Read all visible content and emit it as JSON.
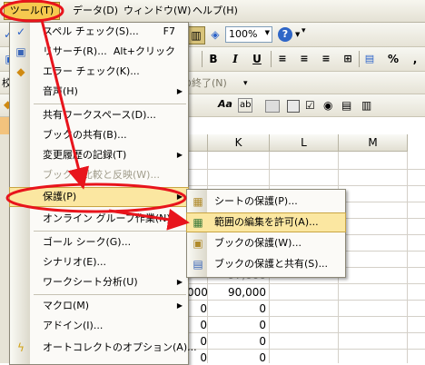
{
  "menubar": {
    "tools": "ツール(T)",
    "data": "データ(D)",
    "window": "ウィンドウ(W)",
    "help": "ヘルプ(H)"
  },
  "toolbar": {
    "zoom": "100%",
    "bold": "B",
    "italic": "I",
    "underline": "U",
    "percent": "%",
    "comma": ",",
    "review_end": "の終了(N)",
    "review_prefix": "校",
    "aa_label": "Aa",
    "ab_label": "ab"
  },
  "grid": {
    "columns": [
      "K",
      "L",
      "M"
    ],
    "cells": {
      "j_partial": "000",
      "k_value": "90,000",
      "k_top_partial": "97,000",
      "zeros": [
        "0",
        "0",
        "0",
        "0"
      ],
      "left_partial": "合"
    }
  },
  "tools_menu": {
    "items": [
      {
        "label": "スペル チェック(S)...",
        "shortcut": "F7"
      },
      {
        "label": "リサーチ(R)...",
        "shortcut": "Alt+クリック"
      },
      {
        "label": "エラー チェック(K)..."
      },
      {
        "label": "音声(H)"
      },
      {
        "label": "共有ワークスペース(D)..."
      },
      {
        "label": "ブックの共有(B)..."
      },
      {
        "label": "変更履歴の記録(T)"
      },
      {
        "label": "ブックの比較と反映(W)..."
      },
      {
        "label": "保護(P)"
      },
      {
        "label": "オンライン グループ作業(N)"
      },
      {
        "label": "ゴール シーク(G)..."
      },
      {
        "label": "シナリオ(E)..."
      },
      {
        "label": "ワークシート分析(U)"
      },
      {
        "label": "マクロ(M)"
      },
      {
        "label": "アドイン(I)..."
      },
      {
        "label": "オートコレクトのオプション(A)..."
      }
    ]
  },
  "protect_submenu": {
    "items": [
      {
        "label": "シートの保護(P)..."
      },
      {
        "label": "範囲の編集を許可(A)..."
      },
      {
        "label": "ブックの保護(W)..."
      },
      {
        "label": "ブックの保護と共有(S)..."
      }
    ]
  },
  "colors": {
    "highlight": "#fbe7a1",
    "annotation_red": "#e8141c",
    "selected_header": "#f6c94f"
  }
}
